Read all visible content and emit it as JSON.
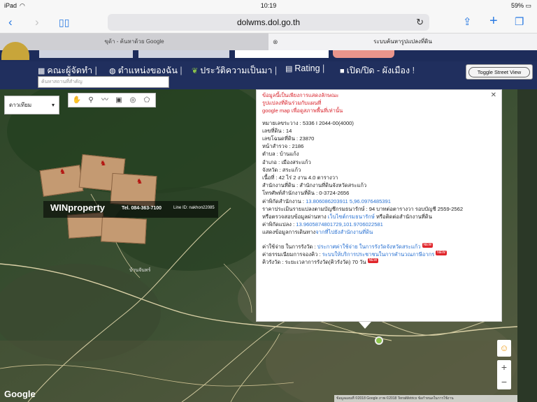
{
  "status": {
    "device": "iPad",
    "time": "10:19",
    "battery": "59%"
  },
  "browser": {
    "url": "dolwms.dol.go.th",
    "tabs": [
      "ขุด้า - ค้นหาด้วย Google",
      "ระบบค้นหารูปแปลงที่ดิน"
    ]
  },
  "nav": {
    "items": [
      "คณะผู้จัดทำ",
      "ตำแหน่งของฉัน",
      "ประวัติความเป็นมา",
      "Rating",
      "เปิด/ปิด - ผังเมือง"
    ],
    "search_placeholder": "ค้นหาสถานที่สำคัญ",
    "street_view_label": "Toggle Street View"
  },
  "map": {
    "type_selected": "ดาวเทียม",
    "zoom_in": "+",
    "zoom_out": "−",
    "google_logo": "Google",
    "attribution": "ข้อมูลแผนที่ ©2018 Google ภาพ ©2018 TerraMetrics   ข้อกำหนดในการใช้งาน",
    "place_label": "บ้านจันทร์"
  },
  "watermark": {
    "brand": "WINproperty",
    "tel": "Tel. 084-363-7100",
    "line": "Line ID: nakhon22085"
  },
  "info": {
    "notice": [
      "ข้อมูลนี้เป็นเพียงการแสดงลักษณะ",
      "รูปแปลงที่ดินร่วมกับแผนที่",
      "google map เพื่อดูสภาพพื้นที่เท่านั้น"
    ],
    "rows": [
      "หมายเลขระวาง : 5336 I 2044-00(4000)",
      "เลขที่ดิน : 14",
      "เลขโฉนดที่ดิน : 23870",
      "หน้าสำรวจ : 2186",
      "ตำบล : บ้านแก้ง",
      "อำเภอ : เมืองสระแก้ว",
      "จังหวัด : สระแก้ว",
      "เนื้อที่ : 42 ไร่ 2 งาน 4.0 ตารางวา",
      "สำนักงานที่ดิน : สำนักงานที่ดินจังหวัดสระแก้ว",
      "โทรศัพท์สำนักงานที่ดิน : 0-3724-2656"
    ],
    "office_coord_label": "ค่าพิกัดสำนักงาน : ",
    "office_coord": "13.806086203911 5,96.0976485391",
    "price": "ราคาประเมินรายแปลงตามบัญชีกรมธนารักษ์ : 94 บาทต่อตารางวา รอบบัญชี 2559-2562",
    "check_prefix": "หรือตรวจสอบข้อมูลผ่านทาง ",
    "check_link": "เว็บไซต์กรมธนารักษ์",
    "check_suffix": " หรือติดต่อสำนักงานที่ดิน",
    "parcel_coord_label": "ค่าพิกัดแปลง : ",
    "parcel_coord": "13.9605874801729,101.9706022581",
    "show_prefix": "แสดงข้อมูลการเดินทาง",
    "show_link": "จากที่ไปยังสำนักงานที่ดิน",
    "fee_label": "ค่าใช้จ่าย ในการรังวัด : ",
    "fee_link": "ประกาศค่าใช้จ่าย ในการรังวัดจังหวัดสระแก้ว",
    "queue_label": "ค่าธรรมเนียมการจองคิว : ",
    "queue_link": "ระบบให้บริการประชาชนในการคำนวณภาษีอากร",
    "wait": "คิวรังวัด : ระยะเวลาการรังวัด(คิวรังวัด) 70 วัน",
    "new_badge": "NEW"
  }
}
